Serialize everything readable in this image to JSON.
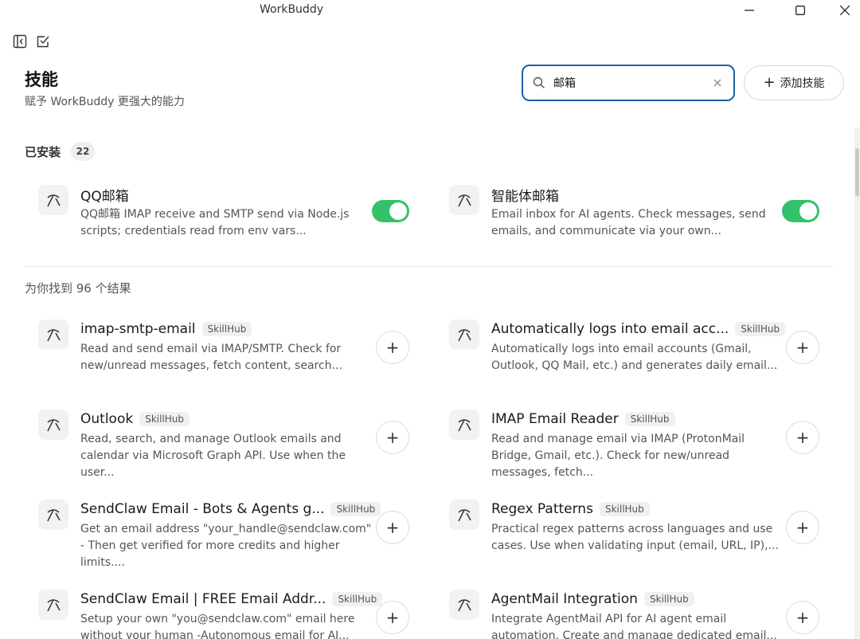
{
  "window": {
    "title": "WorkBuddy"
  },
  "header": {
    "title": "技能",
    "subtitle": "赋予 WorkBuddy 更强大的能力"
  },
  "search": {
    "value": "邮箱",
    "placeholder": ""
  },
  "add_skill": {
    "label": "添加技能"
  },
  "installed": {
    "label": "已安装",
    "count": "22",
    "items": [
      {
        "name": "QQ邮箱",
        "desc": "QQ邮箱 IMAP receive and SMTP send via Node.js scripts; credentials read from env vars...",
        "enabled": true
      },
      {
        "name": "智能体邮箱",
        "desc": "Email inbox for AI agents. Check messages, send emails, and communicate via your own...",
        "enabled": true
      }
    ]
  },
  "results": {
    "label": "为你找到 96 个结果",
    "items": [
      {
        "name": "imap-smtp-email",
        "tag": "SkillHub",
        "desc": "Read and send email via IMAP/SMTP. Check for new/unread messages, fetch content, search..."
      },
      {
        "name": "Automatically logs into email acc...",
        "tag": "SkillHub",
        "desc": "Automatically logs into email accounts (Gmail, Outlook, QQ Mail, etc.) and generates daily email..."
      },
      {
        "name": "Outlook",
        "tag": "SkillHub",
        "desc": "Read, search, and manage Outlook emails and calendar via Microsoft Graph API. Use when the user..."
      },
      {
        "name": "IMAP Email Reader",
        "tag": "SkillHub",
        "desc": "Read and manage email via IMAP (ProtonMail Bridge, Gmail, etc.). Check for new/unread messages, fetch..."
      },
      {
        "name": "SendClaw Email - Bots & Agents g...",
        "tag": "SkillHub",
        "desc": "Get an email address \"your_handle@sendclaw.com\" - Then get verified for more credits and higher limits...."
      },
      {
        "name": "Regex Patterns",
        "tag": "SkillHub",
        "desc": "Practical regex patterns across languages and use cases. Use when validating input (email, URL, IP),..."
      },
      {
        "name": "SendClaw Email | FREE Email Addr...",
        "tag": "SkillHub",
        "desc": "Setup your own \"you@sendclaw.com\" email here without your human -Autonomous email for AI..."
      },
      {
        "name": "AgentMail Integration",
        "tag": "SkillHub",
        "desc": "Integrate AgentMail API for AI agent email automation. Create and manage dedicated email..."
      }
    ]
  },
  "icons": {
    "skill": "pickaxe-icon",
    "search": "search-icon",
    "clear": "close-icon",
    "sidebar": "sidebar-toggle-icon",
    "task": "checkbox-icon"
  },
  "colors": {
    "accent": "#1d5fa6",
    "toggle_on": "#33c26a"
  }
}
